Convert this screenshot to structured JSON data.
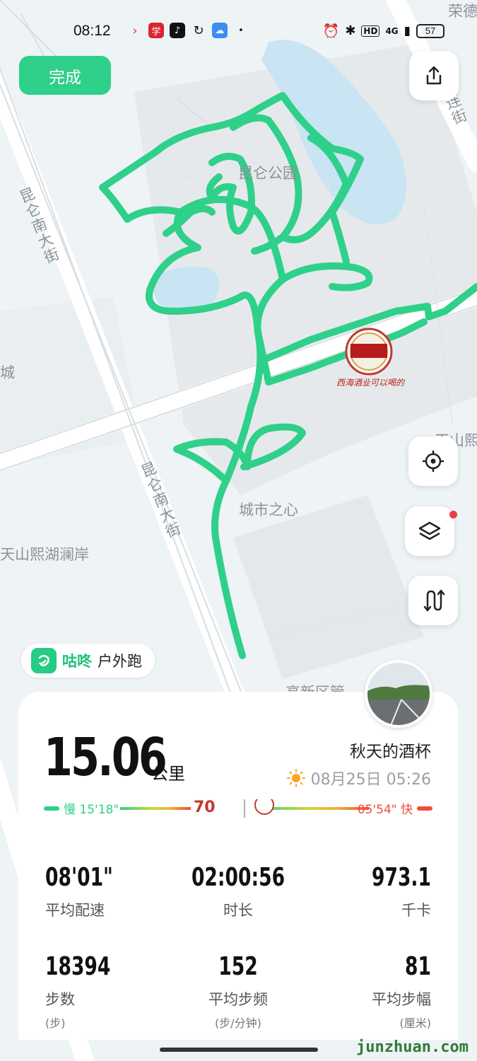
{
  "status_bar": {
    "time": "08:12",
    "network": "4G",
    "hd": "HD",
    "battery": "57"
  },
  "map": {
    "labels": {
      "park": "昆仑公园",
      "city_heart": "城市之心",
      "road_left": "昆仑南大街",
      "road_middle": "昆仑南大街",
      "lakeside": "天山熙湖澜岸",
      "city": "城",
      "tianshan": "天山熙",
      "road_right": "连街",
      "top_right": "荣德",
      "gaoxin": "高新区管"
    },
    "ad_tagline": "西海酒业可以喝的"
  },
  "header": {
    "done_label": "完成"
  },
  "brand": {
    "name": "咕咚",
    "activity": "户外跑"
  },
  "summary": {
    "distance": "15.06",
    "distance_unit": "公里",
    "title": "秋天的酒杯",
    "date": "08月25日 05:26",
    "pace_slow_label": "慢 15'18\"",
    "pace_fast_label": "05'54\" 快"
  },
  "stats": [
    {
      "value": "08'01\"",
      "label": "平均配速",
      "unit": ""
    },
    {
      "value": "02:00:56",
      "label": "时长",
      "unit": ""
    },
    {
      "value": "973.1",
      "label": "千卡",
      "unit": ""
    },
    {
      "value": "18394",
      "label": "步数",
      "unit": "(步)"
    },
    {
      "value": "152",
      "label": "平均步频",
      "unit": "(步/分钟)"
    },
    {
      "value": "81",
      "label": "平均步幅",
      "unit": "(厘米)"
    }
  ],
  "watermark": "junzhuan.com",
  "colors": {
    "accent": "#2fd08a",
    "route": "#2fd08a",
    "fast": "#f24d3a"
  }
}
